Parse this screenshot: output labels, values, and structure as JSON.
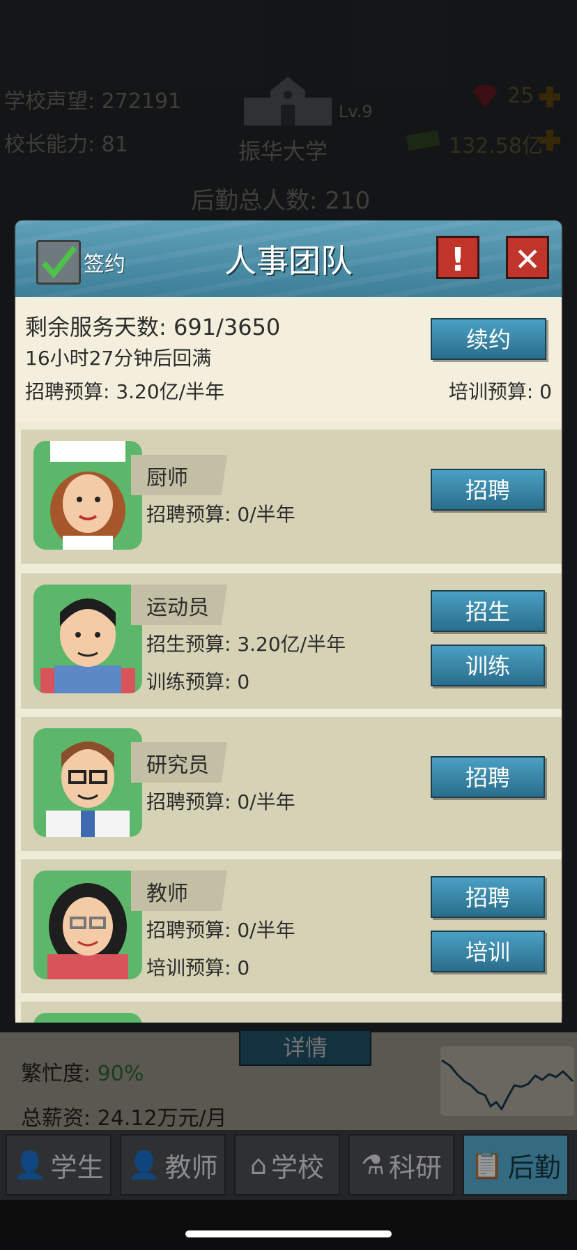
{
  "hud": {
    "reputation_label": "学校声望:",
    "reputation_value": "272191",
    "ability_label": "校长能力:",
    "ability_value": "81",
    "level": "Lv.9",
    "school_name": "振华大学",
    "gems": "25",
    "money": "132.58亿",
    "logistics_total": "后勤总人数: 210"
  },
  "modal": {
    "title": "人事团队",
    "sign_label": "签约",
    "remaining_days_label": "剩余服务天数:",
    "remaining_days_value": "691/3650",
    "refill_text": "16小时27分钟后回满",
    "recruit_budget": "招聘预算: 3.20亿/半年",
    "training_budget": "培训预算: 0",
    "renew_button": "续约",
    "alert_icon": "!",
    "close_icon": "✕"
  },
  "roles": [
    {
      "name": "厨师",
      "line1": "招聘预算: 0/半年",
      "line2": "",
      "buttons": [
        "招聘"
      ],
      "avatar": "chef-avatar"
    },
    {
      "name": "运动员",
      "line1": "招生预算: 3.20亿/半年",
      "line2": "训练预算: 0",
      "buttons": [
        "招生",
        "训练"
      ],
      "avatar": "athlete-avatar"
    },
    {
      "name": "研究员",
      "line1": "招聘预算: 0/半年",
      "line2": "",
      "buttons": [
        "招聘"
      ],
      "avatar": "researcher-avatar"
    },
    {
      "name": "教师",
      "line1": "招聘预算: 0/半年",
      "line2": "培训预算: 0",
      "buttons": [
        "招聘",
        "培训"
      ],
      "avatar": "teacher-avatar"
    }
  ],
  "background": {
    "detail_button": "详情",
    "busy_label": "繁忙度:",
    "busy_value": "90%",
    "salary": "总薪资: 24.12万元/月"
  },
  "tabs": [
    {
      "label": "学生",
      "icon": "student-icon"
    },
    {
      "label": "教师",
      "icon": "teacher-icon"
    },
    {
      "label": "学校",
      "icon": "school-icon"
    },
    {
      "label": "科研",
      "icon": "flask-icon"
    },
    {
      "label": "后勤",
      "icon": "clipboard-icon",
      "active": true
    }
  ],
  "colors": {
    "accent_blue": "#2a6d8c",
    "red_button": "#c0342a",
    "avatar_green": "#5cb76a"
  }
}
